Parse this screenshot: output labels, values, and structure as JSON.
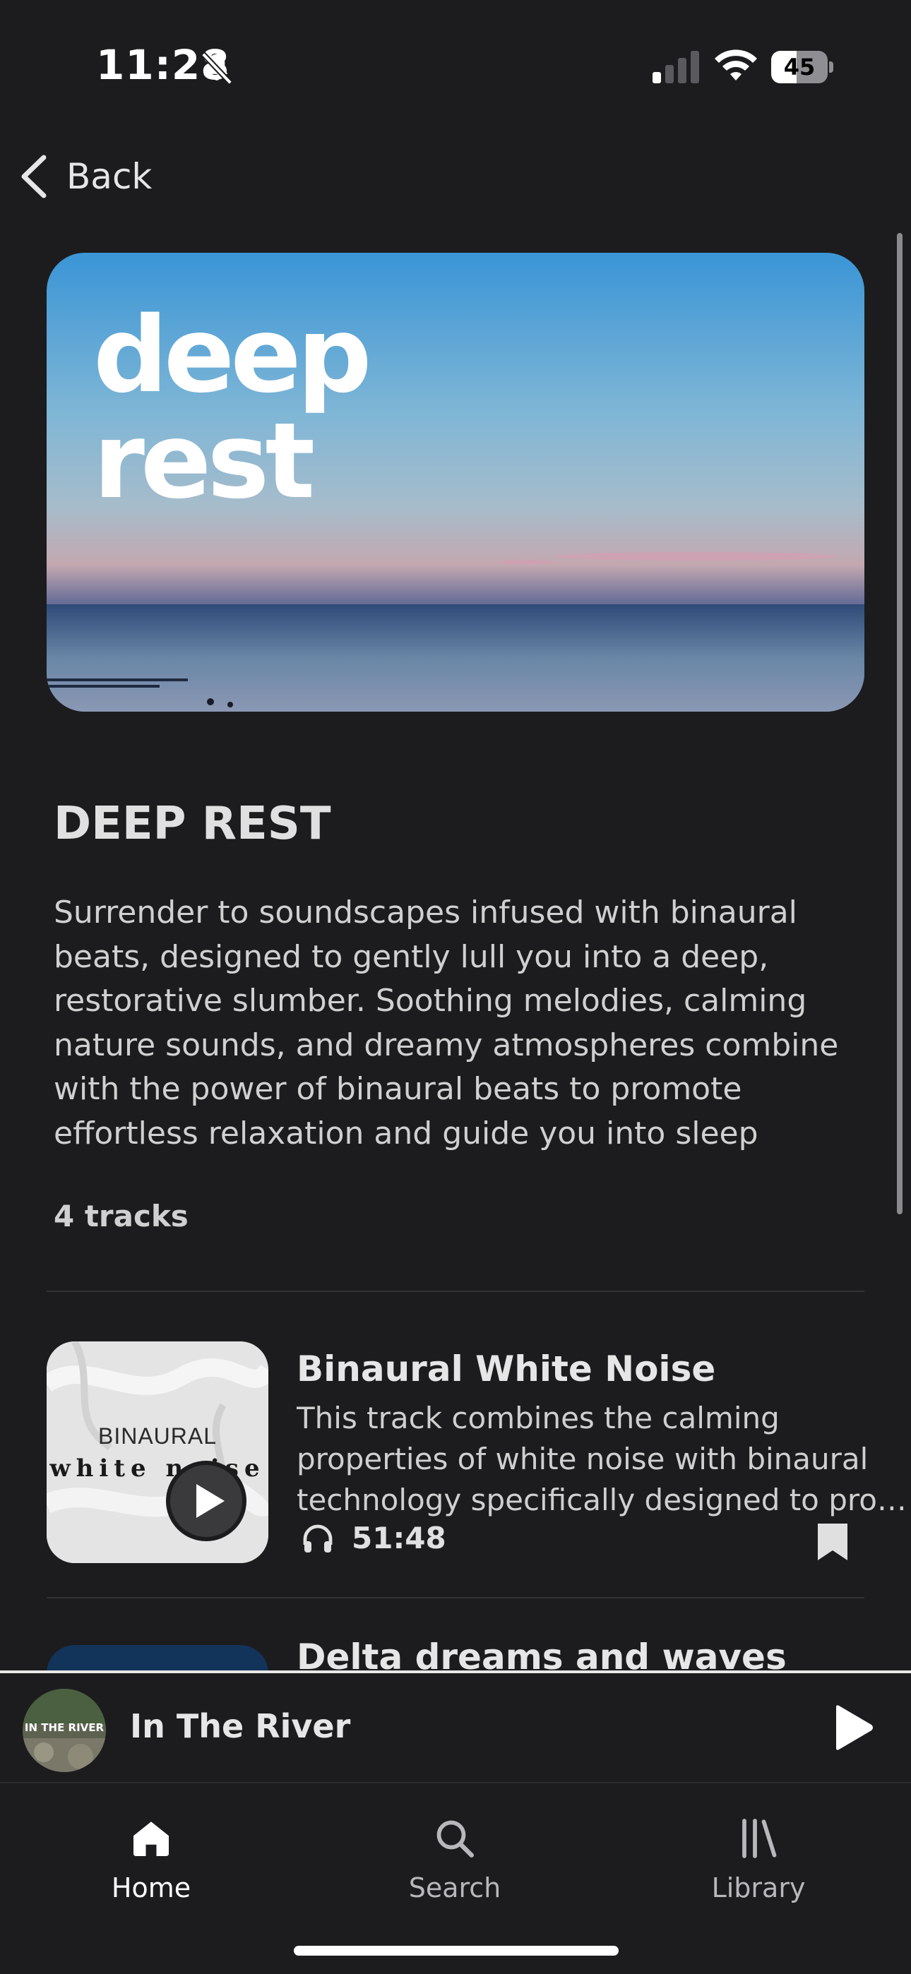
{
  "status_bar": {
    "time": "11:28",
    "battery_percent": 45,
    "battery_label": "45",
    "icons": [
      "bell-slash-icon",
      "cellular-signal-icon",
      "wifi-icon",
      "battery-icon"
    ]
  },
  "nav": {
    "back_label": "Back"
  },
  "hero": {
    "overlay_text": "deep\nrest"
  },
  "playlist": {
    "title": "DEEP REST",
    "description": "Surrender to soundscapes infused with binaural beats, designed to gently lull you into a deep, restorative slumber. Soothing melodies, calming nature sounds, and dreamy atmospheres combine with the power of binaural beats to promote effortless relaxation and guide you into sleep",
    "track_count": "4 tracks"
  },
  "tracks": [
    {
      "title": "Binaural White Noise",
      "description_lines": [
        "This track combines the calming",
        "properties of white noise with binaural",
        "technology specifically designed to pro…"
      ],
      "duration": "51:48",
      "thumb_line1": "BINAURAL",
      "thumb_line2": "white noise"
    },
    {
      "title": "Delta dreams and waves"
    }
  ],
  "mini_player": {
    "title": "In The River",
    "art_text": "IN THE RIVER"
  },
  "tabs": [
    {
      "label": "Home",
      "icon": "home-icon",
      "active": true
    },
    {
      "label": "Search",
      "icon": "search-icon",
      "active": false
    },
    {
      "label": "Library",
      "icon": "library-icon",
      "active": false
    }
  ],
  "colors": {
    "background": "#1c1c1e",
    "text_primary": "#e6e6e6",
    "active_tab": "#ffffff",
    "inactive_tab": "#b8b8bc"
  }
}
